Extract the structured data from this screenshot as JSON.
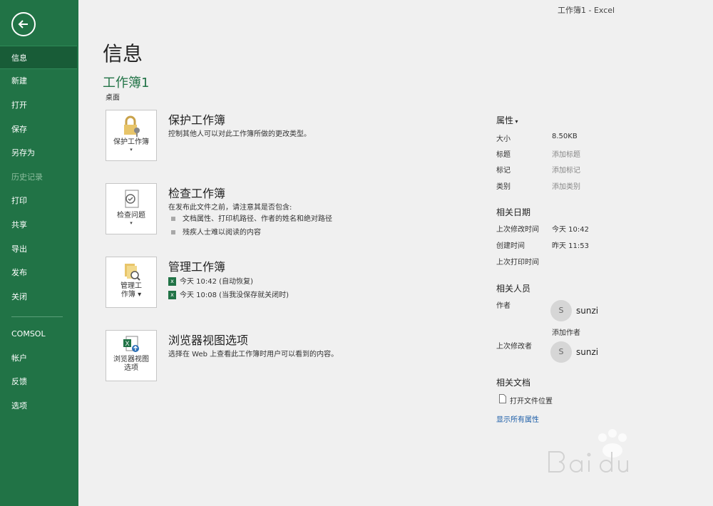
{
  "window_title": "工作簿1  -  Excel",
  "sidebar": {
    "items": [
      {
        "label": "信息",
        "active": true
      },
      {
        "label": "新建"
      },
      {
        "label": "打开"
      },
      {
        "label": "保存"
      },
      {
        "label": "另存为"
      },
      {
        "label": "历史记录",
        "disabled": true
      },
      {
        "label": "打印"
      },
      {
        "label": "共享"
      },
      {
        "label": "导出"
      },
      {
        "label": "发布"
      },
      {
        "label": "关闭"
      },
      {
        "label": "COMSOL"
      },
      {
        "label": "帐户"
      },
      {
        "label": "反馈"
      },
      {
        "label": "选项"
      }
    ]
  },
  "page": {
    "title": "信息",
    "workbook_name": "工作簿1",
    "location": "桌面"
  },
  "sections": {
    "protect": {
      "tile_label": "保护工作簿",
      "heading": "保护工作簿",
      "desc": "控制其他人可以对此工作簿所做的更改类型。"
    },
    "inspect": {
      "tile_label": "检查问题",
      "heading": "检查工作簿",
      "desc": "在发布此文件之前，请注意其是否包含:",
      "bullets": [
        "文档属性、打印机路径、作者的姓名和绝对路径",
        "残疾人士难以阅读的内容"
      ]
    },
    "manage": {
      "tile_label_1": "管理工",
      "tile_label_2": "作簿",
      "heading": "管理工作簿",
      "versions": [
        "今天 10:42 (自动恢复)",
        "今天 10:08 (当我没保存就关闭时)"
      ]
    },
    "browser": {
      "tile_label_1": "浏览器视图",
      "tile_label_2": "选项",
      "heading": "浏览器视图选项",
      "desc": "选择在 Web 上查看此工作簿时用户可以看到的内容。"
    }
  },
  "properties": {
    "heading": "属性",
    "rows": [
      {
        "label": "大小",
        "value": "8.50KB"
      },
      {
        "label": "标题",
        "value": "添加标题"
      },
      {
        "label": "标记",
        "value": "添加标记"
      },
      {
        "label": "类别",
        "value": "添加类别"
      }
    ],
    "dates_heading": "相关日期",
    "dates": [
      {
        "label": "上次修改时间",
        "value": "今天 10:42"
      },
      {
        "label": "创建时间",
        "value": "昨天 11:53"
      },
      {
        "label": "上次打印时间",
        "value": ""
      }
    ],
    "people_heading": "相关人员",
    "author_label": "作者",
    "author_name": "sunzi",
    "author_initial": "S",
    "add_author": "添加作者",
    "last_modified_by_label": "上次修改者",
    "last_modified_by": "sunzi",
    "last_modified_initial": "S",
    "docs_heading": "相关文档",
    "open_location": "打开文件位置",
    "show_all": "显示所有属性"
  },
  "colors": {
    "accent": "#217346",
    "sidebar_active": "#185c37",
    "link": "#1e5fa8"
  }
}
